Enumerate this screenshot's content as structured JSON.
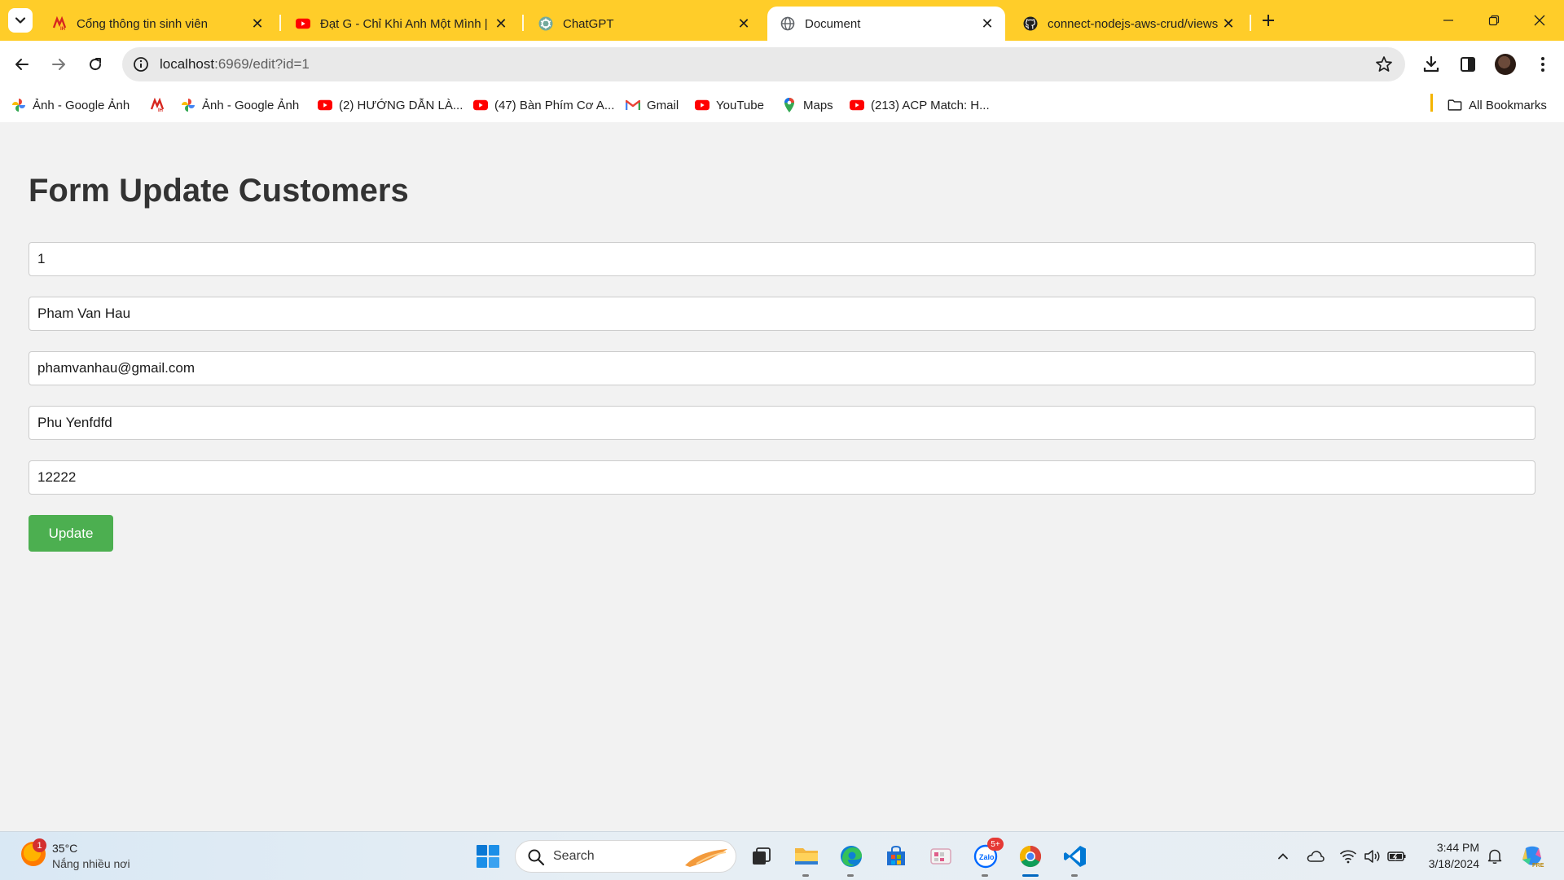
{
  "browser": {
    "tabs": [
      {
        "title": "Cổng thông tin sinh viên",
        "favicon": "university-logo-icon"
      },
      {
        "title": "Đạt G - Chỉ Khi Anh Một Mình |",
        "favicon": "youtube-icon"
      },
      {
        "title": "ChatGPT",
        "favicon": "chatgpt-icon"
      },
      {
        "title": "Document",
        "favicon": "globe-icon"
      },
      {
        "title": "connect-nodejs-aws-crud/views",
        "favicon": "github-icon"
      }
    ],
    "active_tab_index": 3,
    "address": {
      "host": "localhost",
      "path": ":6969/edit?id=1"
    },
    "bookmarks": [
      {
        "label": "Ảnh - Google Ảnh",
        "icon": "google-photos-icon"
      },
      {
        "label": "",
        "icon": "university-logo-icon"
      },
      {
        "label": "Ảnh - Google Ảnh",
        "icon": "google-photos-icon"
      },
      {
        "label": "(2) HƯỚNG DẪN LÀ...",
        "icon": "youtube-icon"
      },
      {
        "label": "(47) Bàn Phím Cơ A...",
        "icon": "youtube-icon"
      },
      {
        "label": "Gmail",
        "icon": "gmail-icon"
      },
      {
        "label": "YouTube",
        "icon": "youtube-icon"
      },
      {
        "label": "Maps",
        "icon": "maps-icon"
      },
      {
        "label": "(213) ACP Match: H...",
        "icon": "youtube-icon"
      }
    ],
    "all_bookmarks_label": "All Bookmarks"
  },
  "page": {
    "title": "Form Update Customers",
    "fields": [
      {
        "name": "id",
        "value": "1"
      },
      {
        "name": "name",
        "value": "Pham Van Hau"
      },
      {
        "name": "email",
        "value": "phamvanhau@gmail.com"
      },
      {
        "name": "address",
        "value": "Phu Yenfdfd"
      },
      {
        "name": "phone",
        "value": "12222"
      }
    ],
    "submit_label": "Update"
  },
  "taskbar": {
    "weather": {
      "temp": "35°C",
      "desc": "Nắng nhiều nơi",
      "badge": "1"
    },
    "search_label": "Search",
    "zalo_badge": "5+",
    "time": "3:44 PM",
    "date": "3/18/2024"
  },
  "colors": {
    "tab_strip": "#ffcd29",
    "page_background": "#f2f2f2",
    "title_text": "#333333",
    "update_button": "#4caf50"
  }
}
